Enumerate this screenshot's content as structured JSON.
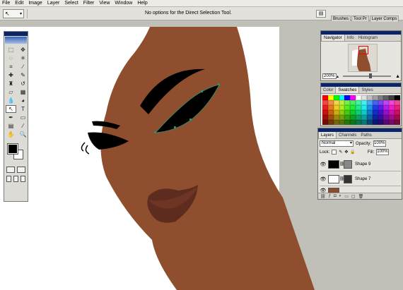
{
  "menu": [
    "File",
    "Edit",
    "Image",
    "Layer",
    "Select",
    "Filter",
    "View",
    "Window",
    "Help"
  ],
  "options_bar": {
    "message": "No options for the Direct Selection Tool."
  },
  "palette_well_tabs": [
    "Brushes",
    "Tool Pr",
    "Layer Comps"
  ],
  "navigator": {
    "tabs": [
      "Navigator",
      "Info",
      "Histogram"
    ],
    "zoom": "200%"
  },
  "swatches_panel": {
    "tabs": [
      "Color",
      "Swatches",
      "Styles"
    ]
  },
  "layers_panel": {
    "tabs": [
      "Layers",
      "Channels",
      "Paths"
    ],
    "blend_mode": "Normal",
    "opacity_label": "Opacity:",
    "opacity": "100%",
    "lock_label": "Lock:",
    "fill_label": "Fill:",
    "fill": "100%",
    "layers": [
      {
        "name": "Shape 9",
        "thumb_color": "#000000"
      },
      {
        "name": "Shape 7",
        "thumb_color": "#ffffff"
      },
      {
        "name": "",
        "thumb_color": "#8c4a2c"
      }
    ]
  },
  "colors": {
    "skin": "#8f4f2e",
    "lips": "#5e2c1f",
    "hair": "#ffffff",
    "canvas_bg": "#c0c0b8",
    "selection": "#2d8f6a"
  }
}
